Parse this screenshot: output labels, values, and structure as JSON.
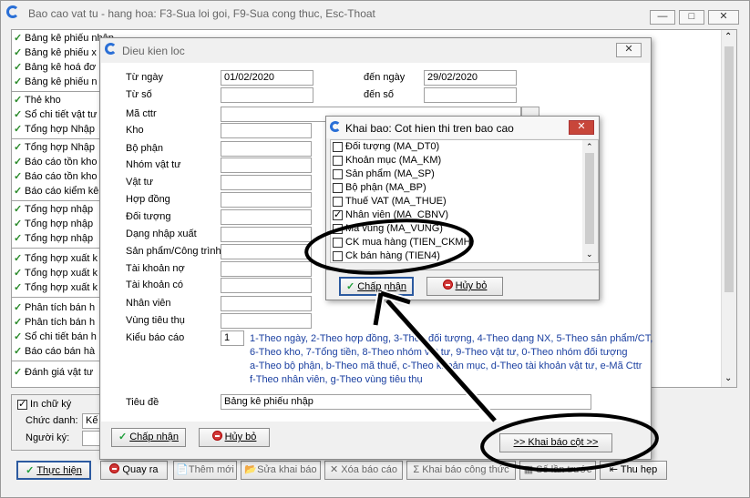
{
  "main": {
    "title": "Bao cao vat tu - hang hoa: F3-Sua loi goi, F9-Sua cong thuc, Esc-Thoat",
    "report_list": [
      "Bảng kê phiếu nhập",
      "Bảng kê phiếu x",
      "Bảng kê hoá đơ",
      "Bảng kê phiếu n",
      "Thẻ kho",
      "Sổ chi tiết vật tư",
      "Tổng hợp Nhập",
      "Tổng hợp Nhập",
      "Báo cáo tồn kho",
      "Báo cáo tồn kho",
      "Báo cáo kiểm kê",
      "Tổng hợp nhập",
      "Tổng hợp nhập",
      "Tổng hợp nhập",
      "Tổng hợp xuất k",
      "Tổng hợp xuất k",
      "Tổng hợp xuất k",
      "Phân tích bán h",
      "Phân tích bán h",
      "Sổ chi tiết bán h",
      "Báo cáo bán hà",
      "Đánh giá vật tư"
    ],
    "print_signer_label": "In chữ ký",
    "title_label": "Chức danh:",
    "title_value": "Kế",
    "signer_label": "Người ký:",
    "signer_value": "",
    "buttons": {
      "execute": "Thực hiện",
      "back": "Quay ra",
      "add_new": "Thêm mới",
      "edit_decl": "Sửa khai báo",
      "delete_report": "Xóa báo cáo",
      "column_decl": "Khai báo công thức",
      "prev_run": "Số lần trước",
      "narrow": "Thu hẹp"
    }
  },
  "filter": {
    "title": "Dieu kien loc",
    "from_date_label": "Từ ngày",
    "from_date": "01/02/2020",
    "to_date_label": "đến ngày",
    "to_date": "29/02/2020",
    "from_no_label": "Từ số",
    "to_no_label": "đến số",
    "ma_ctu_label": "Mã cttr",
    "kho_label": "Kho",
    "bo_phan_label": "Bộ phận",
    "nhom_vt_label": "Nhóm vật tư",
    "vat_tu_label": "Vật tư",
    "hop_dong_label": "Hợp đồng",
    "doi_tuong_label": "Đối tượng",
    "dang_nx_label": "Dạng nhập xuất",
    "sp_ct_label": "Sản phẩm/Công trình",
    "tk_no_label": "Tài khoản nợ",
    "tk_co_label": "Tài khoản có",
    "nhan_vien_label": "Nhân viên",
    "vung_label": "Vùng tiêu thụ",
    "kieu_bc_label": "Kiểu báo cáo",
    "kieu_bc_value": "1",
    "kieu_bc_help": [
      "1-Theo ngày, 2-Theo hợp đồng, 3-Theo đối tượng, 4-Theo dạng NX, 5-Theo sản phẩm/CT,",
      "6-Theo kho, 7-Tổng tiền, 8-Theo nhóm vật tư, 9-Theo vật tư, 0-Theo nhóm đối tượng",
      "a-Theo bộ phận,  b-Theo mã thuế, c-Theo khoản mục, d-Theo tài khoản vật tư, e-Mã Cttr",
      "f-Theo nhân viên, g-Theo vùng tiêu thụ"
    ],
    "tieu_de_label": "Tiêu đề",
    "tieu_de_value": "Bảng kê phiếu nhập",
    "ok": "Chấp nhận",
    "cancel": "Hủy bỏ",
    "col_decl": ">> Khai báo cột >>"
  },
  "columns_dialog": {
    "title": "Khai bao: Cot hien thi tren bao cao",
    "items": [
      {
        "label": "Đối tượng (MA_DT0)",
        "checked": false
      },
      {
        "label": "Khoản mục (MA_KM)",
        "checked": false
      },
      {
        "label": "Sản phẩm (MA_SP)",
        "checked": false
      },
      {
        "label": "Bộ phận (MA_BP)",
        "checked": false
      },
      {
        "label": "Thuế VAT (MA_THUE)",
        "checked": false
      },
      {
        "label": "Nhân viên (MA_CBNV)",
        "checked": true
      },
      {
        "label": "Mã vùng (MA_VUNG)",
        "checked": false
      },
      {
        "label": "CK mua hàng (TIEN_CKMH)",
        "checked": false
      },
      {
        "label": "Ck bán hàng (TIEN4)",
        "checked": false
      }
    ],
    "ok": "Chấp nhận",
    "cancel": "Hủy bỏ"
  }
}
